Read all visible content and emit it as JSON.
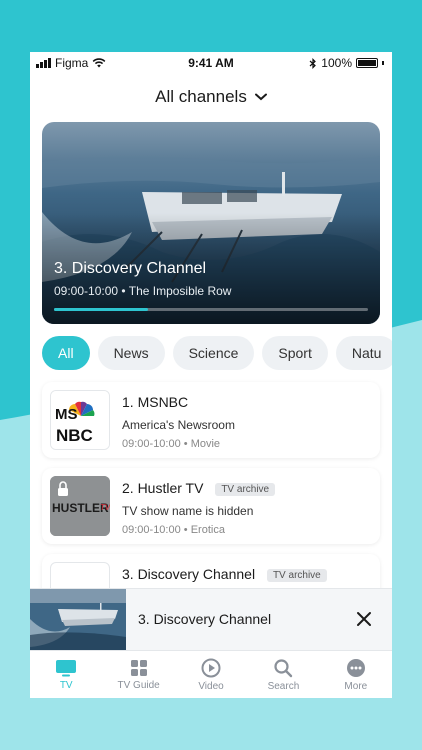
{
  "colors": {
    "accent": "#2ec4cf",
    "background": "#2ec4cf",
    "wave": "#9ee4ea"
  },
  "status_bar": {
    "carrier": "Figma",
    "time": "9:41 AM",
    "battery": "100%"
  },
  "header": {
    "title": "All channels",
    "icon": "chevron-down-icon"
  },
  "hero": {
    "title": "3. Discovery Channel",
    "time": "09:00-10:00",
    "program": "The Imposible Row",
    "progress": 0.3
  },
  "filters": [
    "All",
    "News",
    "Science",
    "Sport",
    "Natu"
  ],
  "channels": [
    {
      "title": "1. MSNBC",
      "badge": "",
      "description": "America's Newsroom",
      "time": "09:00-10:00",
      "genre": "Movie",
      "logo": "MSNBC"
    },
    {
      "title": "2. Hustler TV",
      "badge": "TV archive",
      "description": "TV show name is hidden",
      "time": "09:00-10:00",
      "genre": "Erotica",
      "logo": "HUSTLER"
    },
    {
      "title": "3. Discovery Channel",
      "badge": "TV archive"
    }
  ],
  "mini_player": {
    "title": "3. Discovery Channel"
  },
  "tabs": [
    {
      "label": "TV",
      "icon": "tv-icon"
    },
    {
      "label": "TV Guide",
      "icon": "grid-icon"
    },
    {
      "label": "Video",
      "icon": "play-icon"
    },
    {
      "label": "Search",
      "icon": "search-icon"
    },
    {
      "label": "More",
      "icon": "more-icon"
    }
  ]
}
